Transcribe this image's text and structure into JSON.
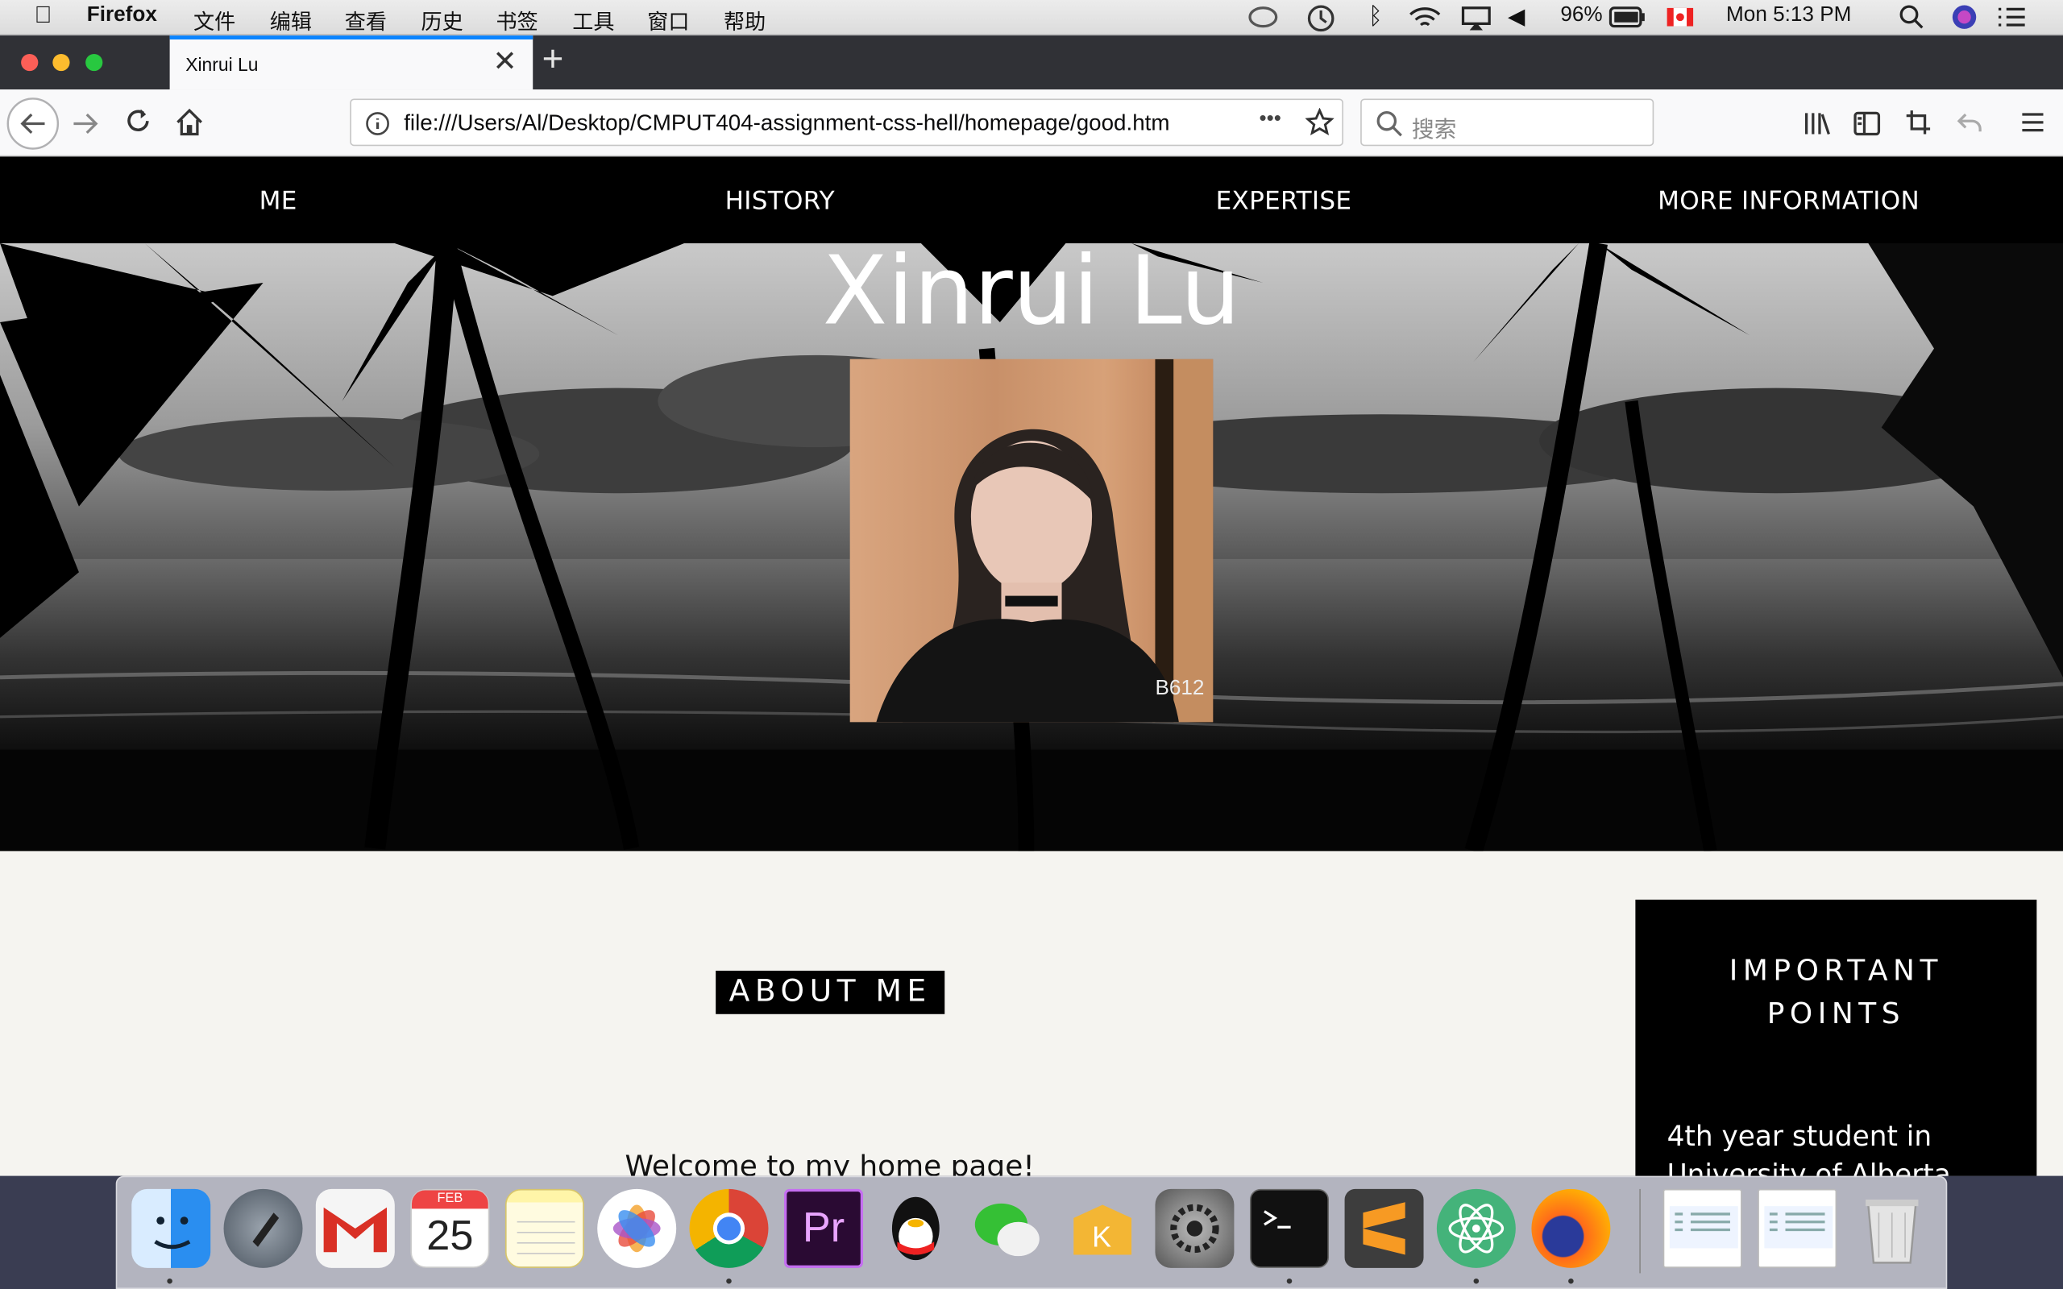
{
  "menubar": {
    "app": "Firefox",
    "items": [
      "文件",
      "编辑",
      "查看",
      "历史",
      "书签",
      "工具",
      "窗口",
      "帮助"
    ],
    "battery": "96%",
    "clock": "Mon 5:13 PM"
  },
  "browser": {
    "tab_title": "Xinrui Lu",
    "new_tab": "+",
    "close_tab": "✕",
    "url": "file:///Users/Al/Desktop/CMPUT404-assignment-css-hell/homepage/good.htm",
    "search_placeholder": "搜索",
    "page_actions": "•••"
  },
  "page": {
    "nav": [
      "ME",
      "HISTORY",
      "EXPERTISE",
      "MORE INFORMATION"
    ],
    "hero_title": "Xinrui Lu",
    "photo_watermark": "B612",
    "about_heading": "ABOUT ME",
    "welcome": "Welcome to my home page!",
    "important_heading_1": "IMPORTANT",
    "important_heading_2": "POINTS",
    "important_body": "4th year student in University of Alberta"
  },
  "dock": {
    "calendar_month": "FEB",
    "calendar_day": "25",
    "premiere": "Pr"
  },
  "colors": {
    "nav_bg": "#000000",
    "page_bg": "#f5f4f0",
    "tab_accent": "#0a84ff"
  }
}
